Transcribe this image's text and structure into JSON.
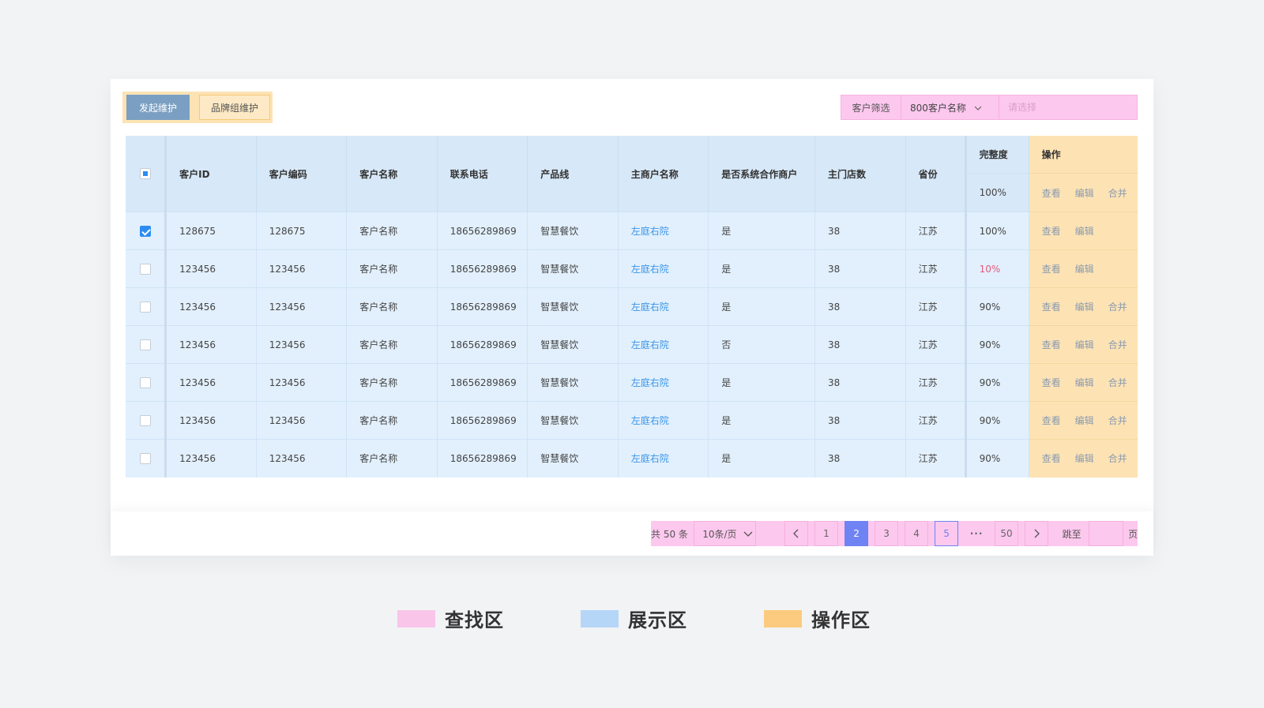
{
  "toolbar": {
    "primary_label": "发起维护",
    "secondary_label": "品牌组维护"
  },
  "filter": {
    "label": "客户筛选",
    "select_value": "800客户名称",
    "input_placeholder": "请选择"
  },
  "table": {
    "headers": {
      "customer_id": "客户ID",
      "customer_code": "客户编码",
      "customer_name": "客户名称",
      "phone": "联系电话",
      "product_line": "产品线",
      "main_merchant": "主商户名称",
      "is_partner": "是否系统合作商户",
      "main_store_count": "主门店数",
      "province": "省份",
      "completeness": "完整度",
      "operations": "操作"
    },
    "header_summary": {
      "completeness": "100%",
      "ops": [
        "查看",
        "编辑",
        "合并"
      ]
    },
    "rows": [
      {
        "checked": true,
        "id": "128675",
        "code": "128675",
        "name": "客户名称",
        "phone": "18656289869",
        "product": "智慧餐饮",
        "merchant": "左庭右院",
        "partner": "是",
        "stores": "38",
        "province": "江苏",
        "completeness": "100%",
        "low": false,
        "ops": [
          "查看",
          "编辑"
        ]
      },
      {
        "checked": false,
        "id": "123456",
        "code": "123456",
        "name": "客户名称",
        "phone": "18656289869",
        "product": "智慧餐饮",
        "merchant": "左庭右院",
        "partner": "是",
        "stores": "38",
        "province": "江苏",
        "completeness": "10%",
        "low": true,
        "ops": [
          "查看",
          "编辑"
        ]
      },
      {
        "checked": false,
        "id": "123456",
        "code": "123456",
        "name": "客户名称",
        "phone": "18656289869",
        "product": "智慧餐饮",
        "merchant": "左庭右院",
        "partner": "是",
        "stores": "38",
        "province": "江苏",
        "completeness": "90%",
        "low": false,
        "ops": [
          "查看",
          "编辑",
          "合并"
        ]
      },
      {
        "checked": false,
        "id": "123456",
        "code": "123456",
        "name": "客户名称",
        "phone": "18656289869",
        "product": "智慧餐饮",
        "merchant": "左庭右院",
        "partner": "否",
        "stores": "38",
        "province": "江苏",
        "completeness": "90%",
        "low": false,
        "ops": [
          "查看",
          "编辑",
          "合并"
        ]
      },
      {
        "checked": false,
        "id": "123456",
        "code": "123456",
        "name": "客户名称",
        "phone": "18656289869",
        "product": "智慧餐饮",
        "merchant": "左庭右院",
        "partner": "是",
        "stores": "38",
        "province": "江苏",
        "completeness": "90%",
        "low": false,
        "ops": [
          "查看",
          "编辑",
          "合并"
        ]
      },
      {
        "checked": false,
        "id": "123456",
        "code": "123456",
        "name": "客户名称",
        "phone": "18656289869",
        "product": "智慧餐饮",
        "merchant": "左庭右院",
        "partner": "是",
        "stores": "38",
        "province": "江苏",
        "completeness": "90%",
        "low": false,
        "ops": [
          "查看",
          "编辑",
          "合并"
        ]
      },
      {
        "checked": false,
        "id": "123456",
        "code": "123456",
        "name": "客户名称",
        "phone": "18656289869",
        "product": "智慧餐饮",
        "merchant": "左庭右院",
        "partner": "是",
        "stores": "38",
        "province": "江苏",
        "completeness": "90%",
        "low": false,
        "ops": [
          "查看",
          "编辑",
          "合并"
        ]
      }
    ]
  },
  "pagination": {
    "total_label": "共 50 条",
    "page_size": "10条/页",
    "pages": [
      "1",
      "2",
      "3",
      "4",
      "5"
    ],
    "active_page": "2",
    "hover_page": "5",
    "ellipsis": "···",
    "last_page": "50",
    "jump_label": "跳至",
    "page_suffix": "页"
  },
  "legend": [
    {
      "label": "查找区",
      "color": "#f9c6ea"
    },
    {
      "label": "展示区",
      "color": "#b6d6f7"
    },
    {
      "label": "操作区",
      "color": "#fccb7f"
    }
  ],
  "colors": {
    "primary_button": "#7b9fc2",
    "link": "#3b95e8",
    "active_page": "#6f83f2",
    "warning_text": "#e55a7a"
  }
}
